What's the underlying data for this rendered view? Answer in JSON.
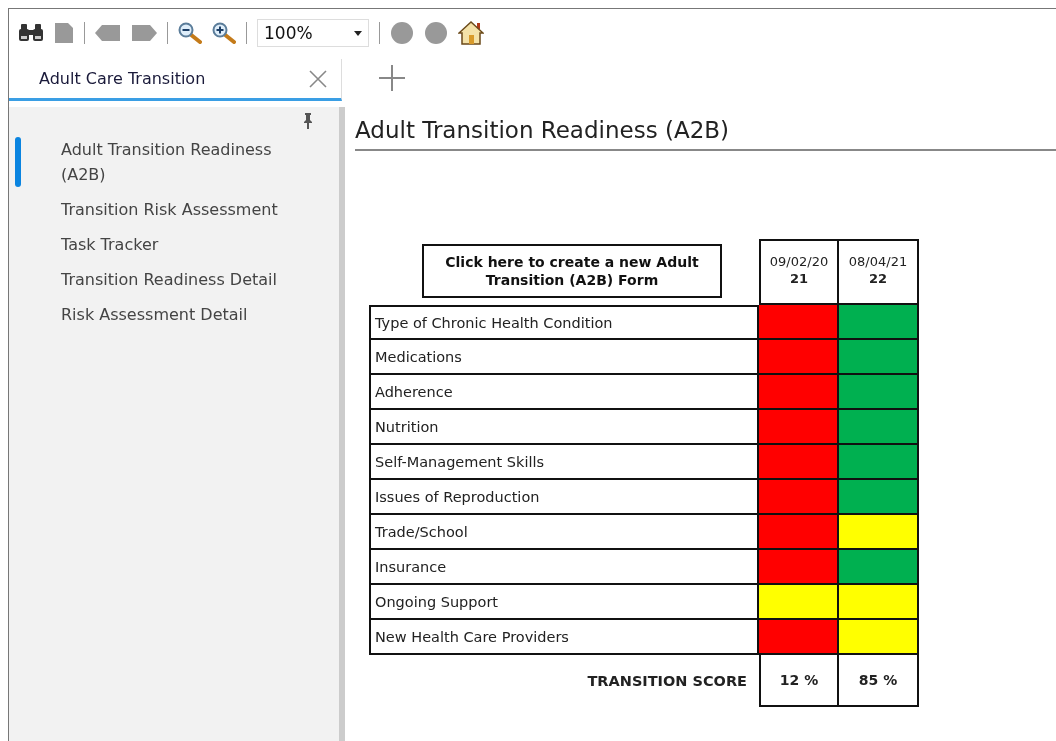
{
  "toolbar": {
    "zoom": {
      "value": "100%"
    }
  },
  "tabs": [
    {
      "label": "Adult Care Transition",
      "selected": true
    }
  ],
  "sidebar": {
    "items": [
      {
        "label": "Adult Transition Readiness (A2B)",
        "selected": true
      },
      {
        "label": "Transition Risk Assessment",
        "selected": false
      },
      {
        "label": "Task Tracker",
        "selected": false
      },
      {
        "label": "Transition Readiness Detail",
        "selected": false
      },
      {
        "label": "Risk Assessment Detail",
        "selected": false
      }
    ]
  },
  "page": {
    "title": "Adult Transition Readiness (A2B)",
    "create_button": "Click here to create a new Adult Transition (A2B) Form",
    "columns": [
      {
        "date": "09/02/20",
        "date_end": "21"
      },
      {
        "date": "08/04/21",
        "date_end": "22"
      }
    ],
    "rows": [
      {
        "label": "Type of Chronic Health Condition",
        "cells": [
          {
            "color": "#ff0000"
          },
          {
            "color": "#00b050"
          }
        ]
      },
      {
        "label": "Medications",
        "cells": [
          {
            "color": "#ff0000"
          },
          {
            "color": "#00b050"
          }
        ]
      },
      {
        "label": "Adherence",
        "cells": [
          {
            "color": "#ff0000"
          },
          {
            "color": "#00b050"
          }
        ]
      },
      {
        "label": "Nutrition",
        "cells": [
          {
            "color": "#ff0000"
          },
          {
            "color": "#00b050"
          }
        ]
      },
      {
        "label": "Self-Management Skills",
        "cells": [
          {
            "color": "#ff0000"
          },
          {
            "color": "#00b050"
          }
        ]
      },
      {
        "label": "Issues of Reproduction",
        "cells": [
          {
            "color": "#ff0000"
          },
          {
            "color": "#00b050"
          }
        ]
      },
      {
        "label": "Trade/School",
        "cells": [
          {
            "color": "#ff0000"
          },
          {
            "color": "#ffff00"
          }
        ]
      },
      {
        "label": "Insurance",
        "cells": [
          {
            "color": "#ff0000"
          },
          {
            "color": "#00b050"
          }
        ]
      },
      {
        "label": "Ongoing Support",
        "cells": [
          {
            "color": "#ffff00"
          },
          {
            "color": "#ffff00"
          }
        ]
      },
      {
        "label": "New Health Care Providers",
        "cells": [
          {
            "color": "#ff0000"
          },
          {
            "color": "#ffff00"
          }
        ]
      }
    ],
    "score": {
      "label": "TRANSITION SCORE",
      "values": [
        "12 %",
        "85 %"
      ]
    }
  }
}
